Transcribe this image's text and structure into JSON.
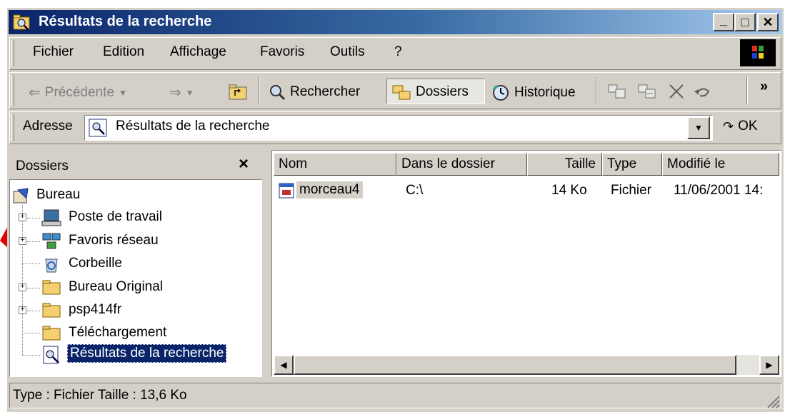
{
  "window": {
    "title": "Résultats de la recherche",
    "minimize": "_",
    "maximize": "□",
    "close": "✕"
  },
  "menubar": {
    "items": [
      {
        "label": "Fichier"
      },
      {
        "label": "Edition"
      },
      {
        "label": "Affichage"
      },
      {
        "label": "Favoris"
      },
      {
        "label": "Outils"
      },
      {
        "label": "?"
      }
    ]
  },
  "toolbar": {
    "back_label": "Précédente",
    "search_label": "Rechercher",
    "folders_label": "Dossiers",
    "history_label": "Historique",
    "more_glyph": "»"
  },
  "address": {
    "label": "Adresse",
    "value": "Résultats de la recherche",
    "go_label": "OK"
  },
  "folders_pane": {
    "title": "Dossiers",
    "close_glyph": "×",
    "tree": [
      {
        "label": "Bureau"
      },
      {
        "label": "Poste de travail"
      },
      {
        "label": "Favoris réseau"
      },
      {
        "label": "Corbeille"
      },
      {
        "label": "Bureau Original"
      },
      {
        "label": "psp414fr"
      },
      {
        "label": "Téléchargement"
      },
      {
        "label": "Résultats de la recherche"
      }
    ]
  },
  "results": {
    "columns": [
      "Nom",
      "Dans le dossier",
      "Taille",
      "Type",
      "Modifié le"
    ],
    "rows": [
      {
        "name": "morceau4",
        "folder": "C:\\",
        "size": "14 Ko",
        "type": "Fichier",
        "modified": "11/06/2001 14:"
      }
    ]
  },
  "statusbar": {
    "text": "Type : Fichier Taille : 13,6 Ko"
  },
  "colors": {
    "title_start": "#0a246a",
    "title_end": "#a6caf0",
    "chrome": "#d4d0c8",
    "selection": "#0a246a",
    "annotation_arrow": "#e00000"
  },
  "icons": {
    "title": "search-folder-icon",
    "windows_logo": "windows-flag-icon",
    "annotation": "red-arrow-pointer"
  }
}
